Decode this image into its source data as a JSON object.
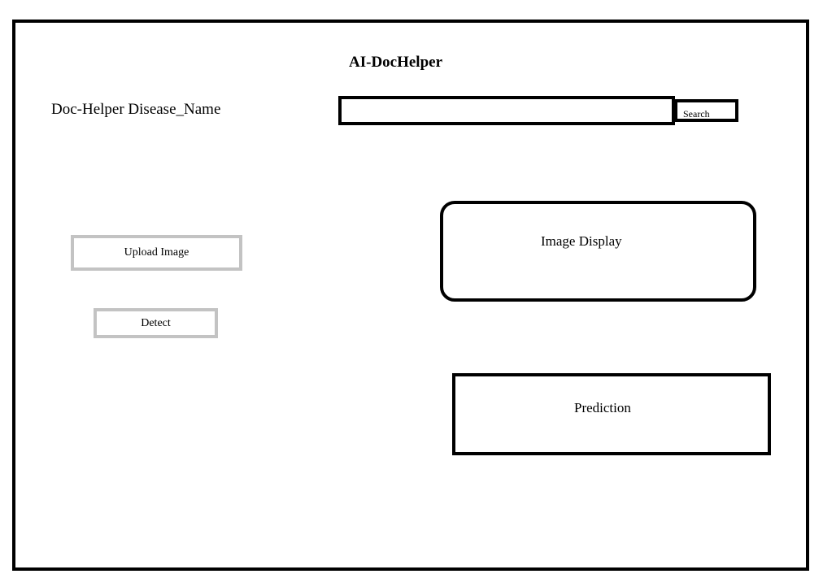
{
  "header": {
    "title": "AI-DocHelper"
  },
  "search": {
    "label": "Doc-Helper Disease_Name",
    "value": "",
    "placeholder": "",
    "button_label": "Search"
  },
  "actions": {
    "upload_label": "Upload Image",
    "detect_label": "Detect"
  },
  "panels": {
    "image_display_label": "Image Display",
    "prediction_label": "Prediction"
  },
  "colors": {
    "border": "#000000",
    "button_border": "#c3c3c3",
    "background": "#ffffff"
  }
}
